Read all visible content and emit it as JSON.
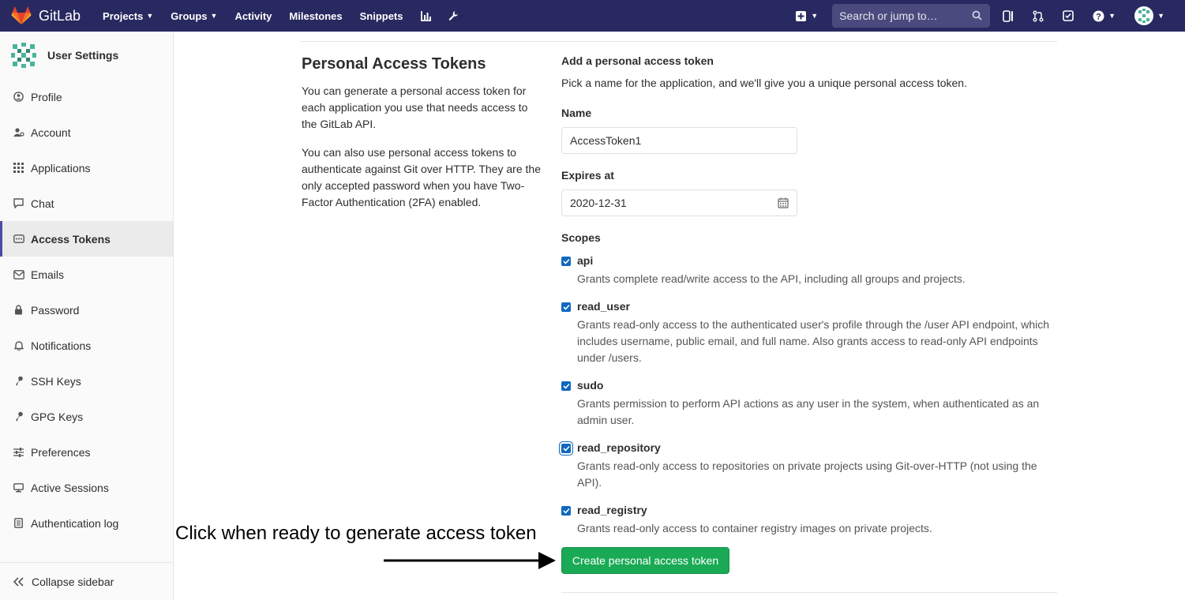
{
  "navbar": {
    "brand": "GitLab",
    "links": [
      "Projects",
      "Groups",
      "Activity",
      "Milestones",
      "Snippets"
    ],
    "search_placeholder": "Search or jump to…",
    "bg_color": "#292961",
    "icons": [
      "chart-icon",
      "wrench-icon",
      "plus-square-icon",
      "search-icon",
      "sidebar-toggle-icon",
      "merge-request-icon",
      "todo-check-icon",
      "help-icon",
      "user-avatar"
    ]
  },
  "sidebar": {
    "title": "User Settings",
    "items": [
      {
        "label": "Profile",
        "icon": "profile-icon"
      },
      {
        "label": "Account",
        "icon": "account-icon"
      },
      {
        "label": "Applications",
        "icon": "applications-icon"
      },
      {
        "label": "Chat",
        "icon": "chat-icon"
      },
      {
        "label": "Access Tokens",
        "icon": "token-icon",
        "active": true
      },
      {
        "label": "Emails",
        "icon": "mail-icon"
      },
      {
        "label": "Password",
        "icon": "lock-icon"
      },
      {
        "label": "Notifications",
        "icon": "bell-icon"
      },
      {
        "label": "SSH Keys",
        "icon": "key-icon"
      },
      {
        "label": "GPG Keys",
        "icon": "key-icon"
      },
      {
        "label": "Preferences",
        "icon": "preferences-icon"
      },
      {
        "label": "Active Sessions",
        "icon": "monitor-icon"
      },
      {
        "label": "Authentication log",
        "icon": "log-icon"
      }
    ],
    "collapse_label": "Collapse sidebar"
  },
  "content": {
    "title": "Personal Access Tokens",
    "para1": "You can generate a personal access token for each application you use that needs access to the GitLab API.",
    "para2": "You can also use personal access tokens to authenticate against Git over HTTP. They are the only accepted password when you have Two-Factor Authentication (2FA) enabled.",
    "form": {
      "heading": "Add a personal access token",
      "description": "Pick a name for the application, and we'll give you a unique personal access token.",
      "name_label": "Name",
      "name_value": "AccessToken1",
      "expires_label": "Expires at",
      "expires_value": "2020-12-31",
      "scopes_label": "Scopes",
      "scopes": [
        {
          "name": "api",
          "checked": true,
          "description": "Grants complete read/write access to the API, including all groups and projects."
        },
        {
          "name": "read_user",
          "checked": true,
          "description": "Grants read-only access to the authenticated user's profile through the /user API endpoint, which includes username, public email, and full name. Also grants access to read-only API endpoints under /users."
        },
        {
          "name": "sudo",
          "checked": true,
          "description": "Grants permission to perform API actions as any user in the system, when authenticated as an admin user."
        },
        {
          "name": "read_repository",
          "checked": true,
          "description": "Grants read-only access to repositories on private projects using Git-over-HTTP (not using the API)."
        },
        {
          "name": "read_registry",
          "checked": true,
          "description": "Grants read-only access to container registry images on private projects."
        }
      ],
      "submit_label": "Create personal access token"
    },
    "annotation": "Click when ready to generate access token"
  },
  "colors": {
    "accent": "#1068bf",
    "button_green": "#1aaa55",
    "sidebar_active_bar": "#4b4ba3"
  }
}
